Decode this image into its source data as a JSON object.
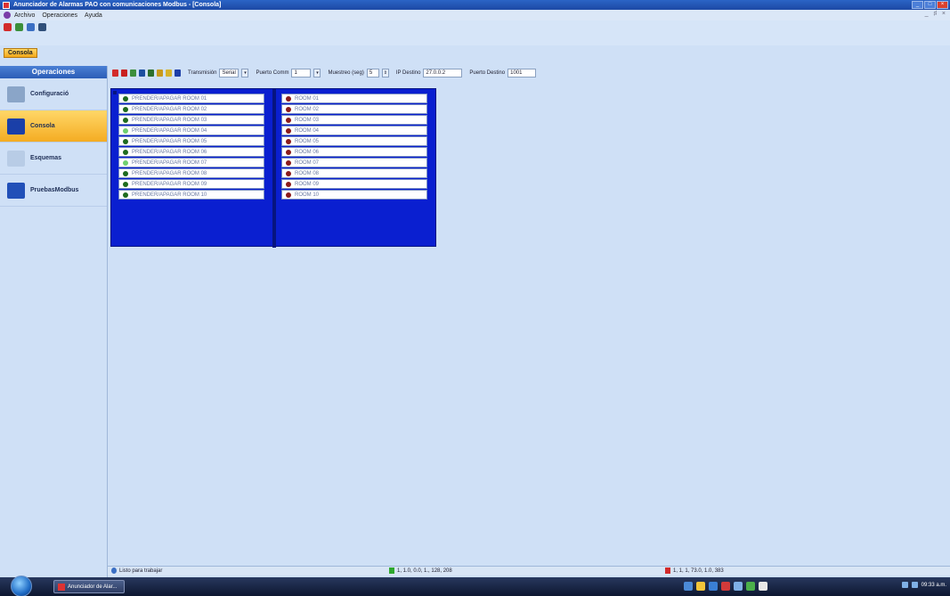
{
  "window": {
    "title": "Anunciador de Alarmas PAO con comunicaciones Modbus - [Consola]"
  },
  "menu": {
    "items": [
      "Archivo",
      "Operaciones",
      "Ayuda"
    ],
    "mdi_controls": "_ ♯ ×"
  },
  "toolbar_icons": [
    {
      "name": "pin-icon",
      "color": "#d22b2b"
    },
    {
      "name": "new-icon",
      "color": "#3b8f3b"
    },
    {
      "name": "monitor-icon",
      "color": "#3a6fc4"
    },
    {
      "name": "globe-icon",
      "color": "#2f4f7a"
    }
  ],
  "active_tab": "Consola",
  "sidebar": {
    "header": "Operaciones",
    "items": [
      {
        "label": "Configuració",
        "icon": "config-icon",
        "color": "#8aa5c8",
        "active": false
      },
      {
        "label": "Consola",
        "icon": "console-icon",
        "color": "#1a3fa8",
        "active": true
      },
      {
        "label": "Esquemas",
        "icon": "schema-icon",
        "color": "#b8cce6",
        "active": false
      },
      {
        "label": "PruebasModbus",
        "icon": "modbus-icon",
        "color": "#2150b8",
        "active": false
      }
    ]
  },
  "panel_toolbar": {
    "icons": [
      {
        "name": "alarm-on-icon",
        "color": "#d22b2b"
      },
      {
        "name": "alarm-off-icon",
        "color": "#c82020"
      },
      {
        "name": "chart-icon",
        "color": "#3c8f3c"
      },
      {
        "name": "save-icon",
        "color": "#1d4fa0"
      },
      {
        "name": "sort-icon",
        "color": "#2d6f2d"
      },
      {
        "name": "bell-icon",
        "color": "#c99a1c"
      },
      {
        "name": "lock-icon",
        "color": "#d6b32a"
      },
      {
        "name": "info-icon",
        "color": "#1d3fa8"
      }
    ],
    "transmision_label": "Transmisión",
    "transmision_value": "Serial",
    "puerto_label": "Puerto Comm",
    "puerto_value": "1",
    "muestreo_label": "Muestreo (seg)",
    "muestreo_value": "5",
    "ip_label": "IP Destino",
    "ip_value": "27.0.0.2",
    "puerto_destino_label": "Puerto Destino",
    "puerto_destino_value": "1001"
  },
  "switches_left": [
    {
      "label": "PRENDER/APAGAR ROOM 01",
      "color": "#1e6b1e"
    },
    {
      "label": "PRENDER/APAGAR ROOM 02",
      "color": "#1e6b1e"
    },
    {
      "label": "PRENDER/APAGAR ROOM 03",
      "color": "#1e6b1e"
    },
    {
      "label": "PRENDER/APAGAR ROOM 04",
      "color": "#6fd06f"
    },
    {
      "label": "PRENDER/APAGAR ROOM 05",
      "color": "#1e6b1e"
    },
    {
      "label": "PRENDER/APAGAR ROOM 06",
      "color": "#1e6b1e"
    },
    {
      "label": "PRENDER/APAGAR ROOM 07",
      "color": "#6fd06f"
    },
    {
      "label": "PRENDER/APAGAR ROOM 08",
      "color": "#1e6b1e"
    },
    {
      "label": "PRENDER/APAGAR ROOM 09",
      "color": "#1e6b1e"
    },
    {
      "label": "PRENDER/APAGAR ROOM 10",
      "color": "#1e6b1e"
    }
  ],
  "switches_right": [
    {
      "label": "ROOM 01",
      "color": "#8b1a1a"
    },
    {
      "label": "ROOM 02",
      "color": "#8b1a1a"
    },
    {
      "label": "ROOM 03",
      "color": "#8b1a1a"
    },
    {
      "label": "ROOM 04",
      "color": "#8b1a1a"
    },
    {
      "label": "ROOM 05",
      "color": "#8b1a1a"
    },
    {
      "label": "ROOM 06",
      "color": "#8b1a1a"
    },
    {
      "label": "ROOM 07",
      "color": "#8b1a1a"
    },
    {
      "label": "ROOM 08",
      "color": "#8b1a1a"
    },
    {
      "label": "ROOM 09",
      "color": "#8b1a1a"
    },
    {
      "label": "ROOM 10",
      "color": "#8b1a1a"
    }
  ],
  "statusbar": {
    "ready_text": "Listo para trabajar",
    "tx_text": "1, 1.0, 0.0, 1., 128, 208",
    "rx_text": "1, 1, 1, 73.0, 1.0, 383"
  },
  "taskbar": {
    "task_label": "Anunciador de Alar...",
    "clock": "09:33 a.m.",
    "tray_app_colors": [
      "#4b8ad6",
      "#f2c53a",
      "#3a7fd6",
      "#d23a3a",
      "#7fb0e6",
      "#4bb04b",
      "#e8e8e8"
    ]
  }
}
